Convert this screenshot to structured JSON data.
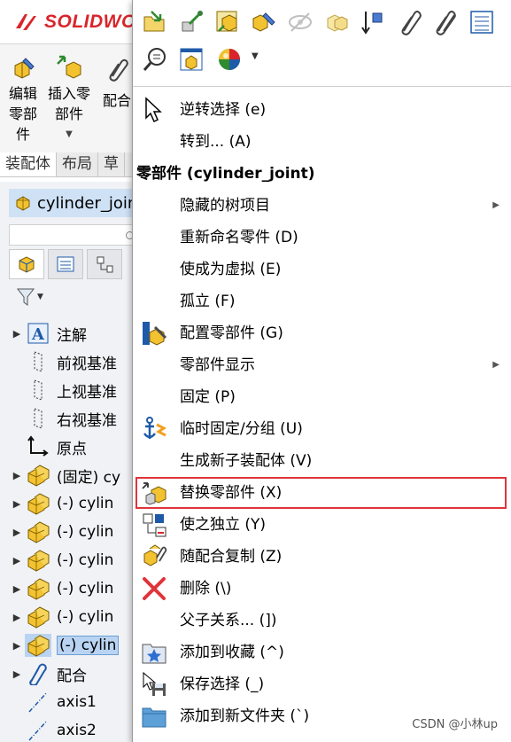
{
  "app": {
    "logo_text": "SOLIDWO",
    "brand_color": "#d9252b"
  },
  "command_bar": {
    "edit_component": {
      "line1": "编辑",
      "line2": "零部",
      "line3": "件"
    },
    "insert_component": {
      "line1": "插入零",
      "line2": "部件"
    },
    "mate": {
      "label": "配合"
    }
  },
  "tabs": [
    "装配体",
    "布局",
    "草"
  ],
  "tree": {
    "header_title": "cylinder_join",
    "rows": [
      {
        "label": "注解",
        "icon": "annotation-icon",
        "expandable": true
      },
      {
        "label": "前视基准",
        "icon": "plane-icon",
        "expandable": false
      },
      {
        "label": "上视基准",
        "icon": "plane-icon",
        "expandable": false
      },
      {
        "label": "右视基准",
        "icon": "plane-icon",
        "expandable": false
      },
      {
        "label": "原点",
        "icon": "origin-icon",
        "expandable": false
      },
      {
        "label": "(固定) cy",
        "icon": "part-icon",
        "expandable": true
      },
      {
        "label": "(-) cylin",
        "icon": "part-icon",
        "expandable": true
      },
      {
        "label": "(-) cylin",
        "icon": "part-icon",
        "expandable": true
      },
      {
        "label": "(-) cylin",
        "icon": "part-icon",
        "expandable": true
      },
      {
        "label": "(-) cylin",
        "icon": "part-icon",
        "expandable": true
      },
      {
        "label": "(-) cylin",
        "icon": "part-icon",
        "expandable": true
      },
      {
        "label": "(-) cylin",
        "icon": "part-icon",
        "expandable": true,
        "selected": true
      },
      {
        "label": "配合",
        "icon": "mates-icon",
        "expandable": true
      },
      {
        "label": "axis1",
        "icon": "axis-icon",
        "expandable": false
      },
      {
        "label": "axis2",
        "icon": "axis-icon",
        "expandable": false
      }
    ]
  },
  "context_menu": {
    "toolbar_icons": [
      "open-part-icon",
      "rebuild-icon",
      "smart-fastener-icon",
      "edit-part-icon",
      "hide-icon",
      "transparency-icon",
      "move-to-icon",
      "mate-clip-icon",
      "mate-clip2-icon",
      "properties-icon",
      "zoom-to-selection-icon",
      "open-drawing-icon",
      "appearance-icon"
    ],
    "items": [
      {
        "label": "逆转选择 (e)",
        "icon": "cursor-icon",
        "submenu": false
      },
      {
        "label": "转到... (A)",
        "icon": "",
        "submenu": false
      },
      {
        "label": "零部件 (cylinder_joint)",
        "icon": "",
        "submenu": false,
        "header": true
      },
      {
        "label": "隐藏的树项目",
        "icon": "",
        "submenu": true
      },
      {
        "label": "重新命名零件 (D)",
        "icon": "",
        "submenu": false
      },
      {
        "label": "使成为虚拟 (E)",
        "icon": "",
        "submenu": false
      },
      {
        "label": "孤立 (F)",
        "icon": "",
        "submenu": false
      },
      {
        "label": "配置零部件 (G)",
        "icon": "configure-component-icon",
        "submenu": false
      },
      {
        "label": "零部件显示",
        "icon": "",
        "submenu": true
      },
      {
        "label": "固定 (P)",
        "icon": "",
        "submenu": false
      },
      {
        "label": "临时固定/分组 (U)",
        "icon": "temp-fix-icon",
        "submenu": false
      },
      {
        "label": "生成新子装配体 (V)",
        "icon": "",
        "submenu": false
      },
      {
        "label": "替换零部件 (X)",
        "icon": "replace-component-icon",
        "submenu": false,
        "highlight": true
      },
      {
        "label": "使之独立 (Y)",
        "icon": "make-independent-icon",
        "submenu": false
      },
      {
        "label": "随配合复制 (Z)",
        "icon": "copy-with-mates-icon",
        "submenu": false
      },
      {
        "label": "删除 (\\)",
        "icon": "delete-icon",
        "submenu": false
      },
      {
        "label": "父子关系... (])",
        "icon": "",
        "submenu": false
      },
      {
        "label": "添加到收藏 (^)",
        "icon": "favorite-icon",
        "submenu": false
      },
      {
        "label": "保存选择 (_)",
        "icon": "save-selection-icon",
        "submenu": false
      },
      {
        "label": "添加到新文件夹 (`)",
        "icon": "folder-icon",
        "submenu": false
      }
    ]
  },
  "watermark": "CSDN @小林up",
  "colors": {
    "highlight_border": "#e0343a",
    "selection": "#b9d4f2",
    "part_yellow": "#f2c230"
  }
}
